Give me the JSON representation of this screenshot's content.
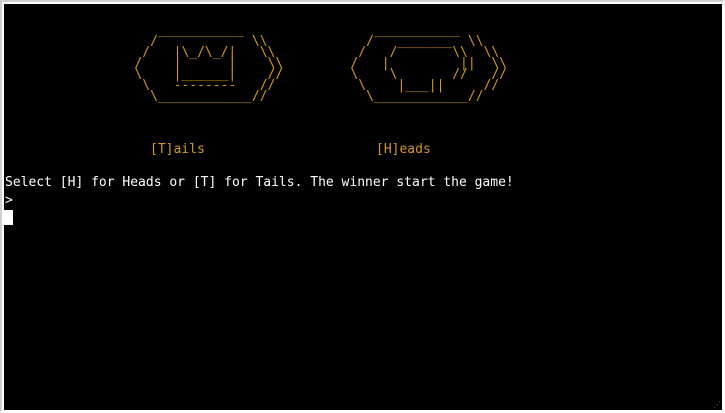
{
  "terminal": {
    "art_tails": "      ___________\n     /            \\\\\n    /   |\\_/\\_/|   \\\\\n   /    |      |    \\\\\n   \\    |______|    //\n    \\   --------   //\n     \\____________//",
    "art_heads": "      ___________\n     /   _______  \\\\\n    /   /       \\\\  \\\\\n   /   |         ||  \\\\\n   \\    \\       //   //\n    \\    |___||     //\n     \\____________//",
    "label_tails": "[T]ails",
    "label_heads": "[H]eads",
    "prompt": "Select [H] for Heads or [T] for Tails. The winner start the game!",
    "input_prefix": ">"
  },
  "colors": {
    "background": "#000000",
    "ascii_art": "#d29a19",
    "text": "#ffffff"
  }
}
